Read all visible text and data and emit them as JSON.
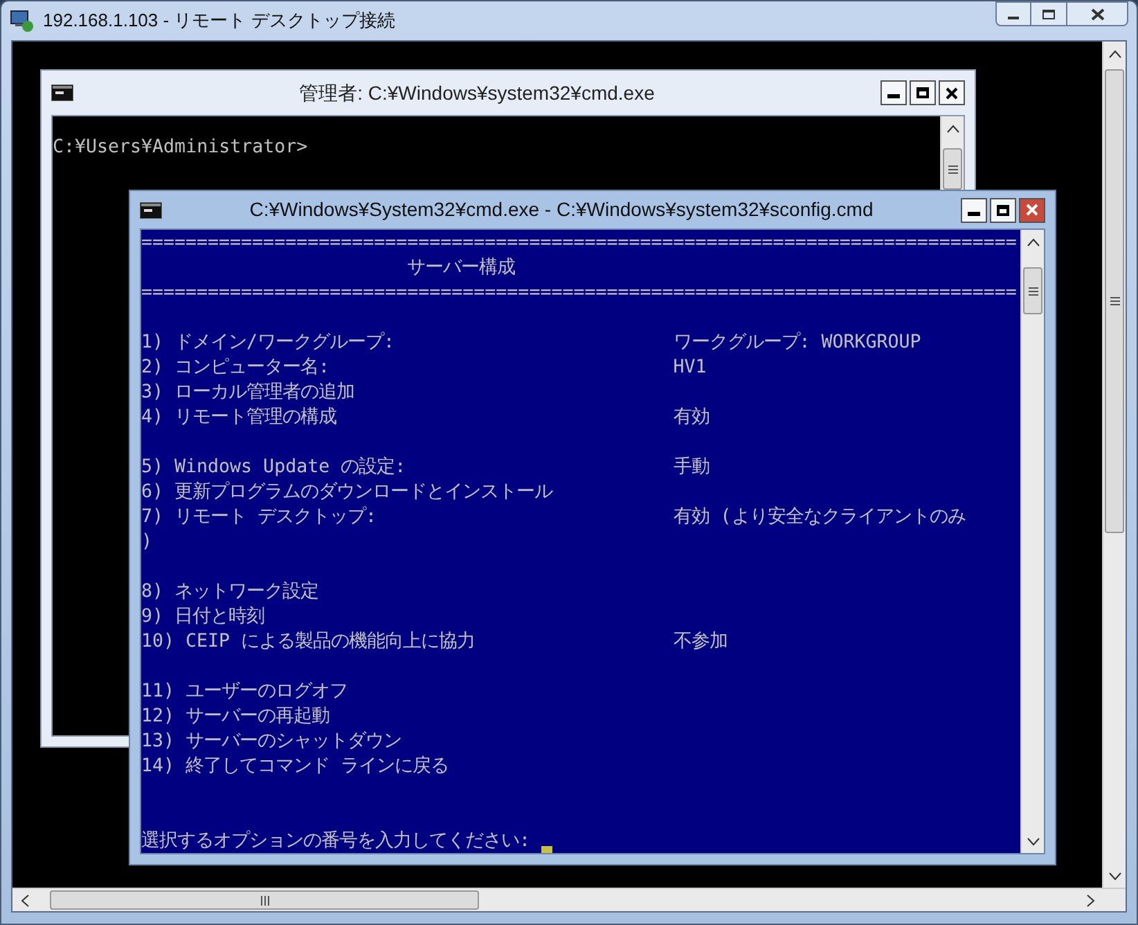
{
  "window": {
    "title": "192.168.1.103 - リモート デスクトップ接続"
  },
  "back_console": {
    "title": "管理者: C:¥Windows¥system32¥cmd.exe",
    "lines": [
      "C:¥Users¥Administrator>"
    ]
  },
  "front_console": {
    "title": "C:¥Windows¥System32¥cmd.exe - C:¥Windows¥system32¥sconfig.cmd",
    "rule": "===============================================================================",
    "heading": "サーバー構成",
    "menu_groups": [
      [
        {
          "label": "1) ドメイン/ワークグループ:",
          "value": "ワークグループ:  WORKGROUP"
        },
        {
          "label": "2) コンピューター名:",
          "value": "HV1"
        },
        {
          "label": "3) ローカル管理者の追加"
        },
        {
          "label": "4) リモート管理の構成",
          "value": "有効"
        }
      ],
      [
        {
          "label": "5) Windows Update の設定:",
          "value": "手動"
        },
        {
          "label": "6) 更新プログラムのダウンロードとインストール"
        },
        {
          "label": "7) リモート デスクトップ:",
          "value": "有効 (より安全なクライアントのみ"
        },
        {
          "label": ")"
        }
      ],
      [
        {
          "label": "8) ネットワーク設定"
        },
        {
          "label": "9) 日付と時刻"
        },
        {
          "label": "10) CEIP による製品の機能向上に協力",
          "value": "不参加"
        }
      ],
      [
        {
          "label": "11) ユーザーのログオフ"
        },
        {
          "label": "12) サーバーの再起動"
        },
        {
          "label": "13) サーバーのシャットダウン"
        },
        {
          "label": "14) 終了してコマンド ラインに戻る"
        }
      ]
    ],
    "prompt": "選択するオプションの番号を入力してください:"
  }
}
